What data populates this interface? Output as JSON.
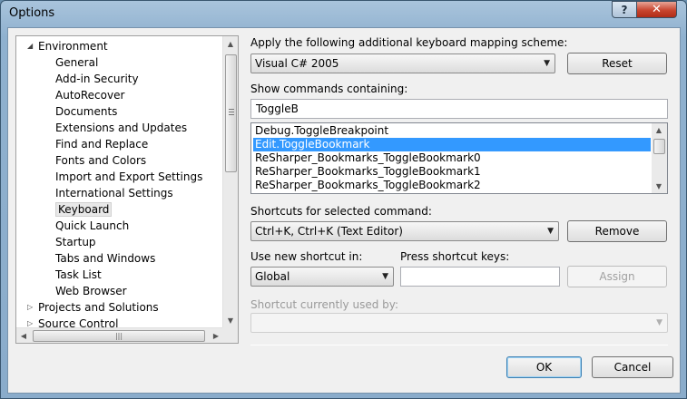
{
  "window": {
    "title": "Options",
    "help": "?",
    "close": "✕"
  },
  "tree": {
    "items": [
      {
        "label": "Environment",
        "level": 0,
        "expanded": true
      },
      {
        "label": "General",
        "level": 1
      },
      {
        "label": "Add-in Security",
        "level": 1
      },
      {
        "label": "AutoRecover",
        "level": 1
      },
      {
        "label": "Documents",
        "level": 1
      },
      {
        "label": "Extensions and Updates",
        "level": 1
      },
      {
        "label": "Find and Replace",
        "level": 1
      },
      {
        "label": "Fonts and Colors",
        "level": 1
      },
      {
        "label": "Import and Export Settings",
        "level": 1
      },
      {
        "label": "International Settings",
        "level": 1
      },
      {
        "label": "Keyboard",
        "level": 1,
        "selected": true
      },
      {
        "label": "Quick Launch",
        "level": 1
      },
      {
        "label": "Startup",
        "level": 1
      },
      {
        "label": "Tabs and Windows",
        "level": 1
      },
      {
        "label": "Task List",
        "level": 1
      },
      {
        "label": "Web Browser",
        "level": 1
      },
      {
        "label": "Projects and Solutions",
        "level": 0,
        "expanded": false
      },
      {
        "label": "Source Control",
        "level": 0,
        "expanded": false
      }
    ]
  },
  "mapping": {
    "label": "Apply the following additional keyboard mapping scheme:",
    "value": "Visual C# 2005",
    "reset": "Reset"
  },
  "commands": {
    "label": "Show commands containing:",
    "filter": "ToggleB",
    "list": [
      "Debug.ToggleBreakpoint",
      "Edit.ToggleBookmark",
      "ReSharper_Bookmarks_ToggleBookmark0",
      "ReSharper_Bookmarks_ToggleBookmark1",
      "ReSharper_Bookmarks_ToggleBookmark2"
    ],
    "selected_index": 1
  },
  "shortcuts": {
    "label": "Shortcuts for selected command:",
    "value": "Ctrl+K, Ctrl+K (Text Editor)",
    "remove": "Remove"
  },
  "new_shortcut": {
    "scope_label": "Use new shortcut in:",
    "scope_value": "Global",
    "keys_label": "Press shortcut keys:",
    "keys_value": "",
    "assign": "Assign"
  },
  "used_by": {
    "label": "Shortcut currently used by:",
    "value": ""
  },
  "footer": {
    "ok": "OK",
    "cancel": "Cancel"
  }
}
